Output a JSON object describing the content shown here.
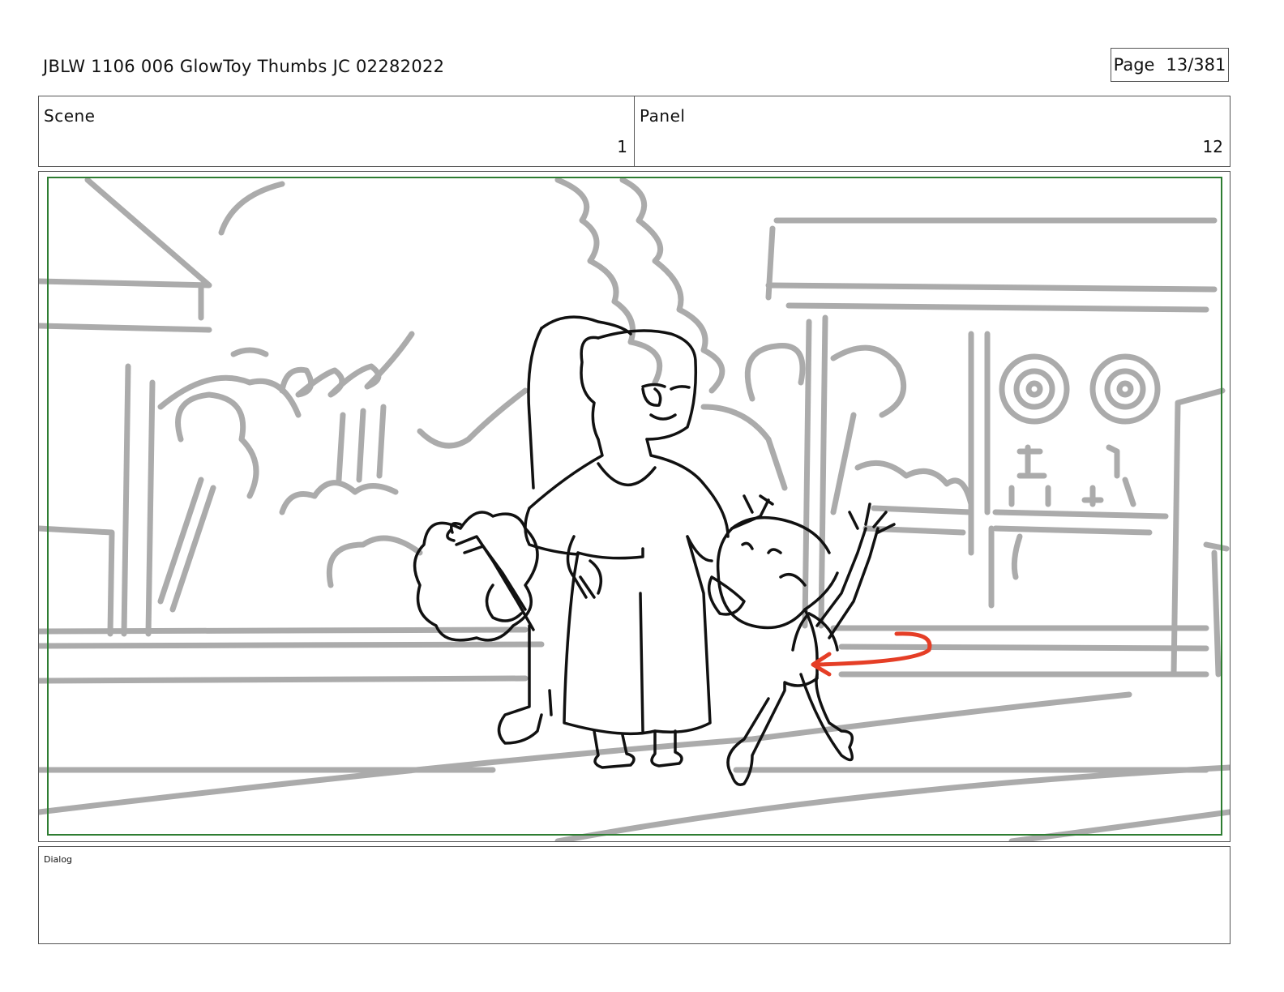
{
  "header": {
    "title": "JBLW 1106 006 GlowToy Thumbs JC 02282022",
    "page_label": "Page",
    "page_value": "13/381"
  },
  "info": {
    "scene_label": "Scene",
    "scene_value": "1",
    "panel_label": "Panel",
    "panel_value": "12"
  },
  "dialog": {
    "label": "Dialog"
  },
  "colors": {
    "safe_frame": "#2e7d32",
    "background_sketch": "#ababab",
    "character_lines": "#111111",
    "motion_arrow": "#e53e26"
  }
}
